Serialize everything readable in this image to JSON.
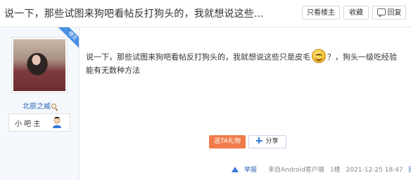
{
  "header": {
    "title": "说一下，那些试图来狗吧看帖反打狗头的，我就想说这些...",
    "buttons": {
      "only_owner": "只看楼主",
      "favorite": "收藏",
      "reply": "回复"
    }
  },
  "author": {
    "badge": "楼主",
    "name": "北辰之威",
    "level_label": "小 吧 主",
    "avatar_icon": "avatar",
    "level_icon": "person-icon"
  },
  "post": {
    "text_before_emoji": "说一下，那些试图来狗吧看帖反打狗头的，我就想说这些只是皮毛",
    "text_after_emoji": "？，狗头一级吃经验能有无数种方法",
    "emoji_icon": "smile-emoji"
  },
  "actions": {
    "gift_label": "送TA礼物",
    "share_label": "分享"
  },
  "footer": {
    "report_label": "举报",
    "source": "来自Android客户端",
    "floor": "1楼",
    "timestamp": "2021-12-25 18:47",
    "reply": "回复"
  },
  "colors": {
    "accent_blue": "#4a90e2",
    "link_blue": "#2d64b3",
    "gift_orange": "#f07c4a",
    "sidebar_bg": "#f5f8fd"
  }
}
